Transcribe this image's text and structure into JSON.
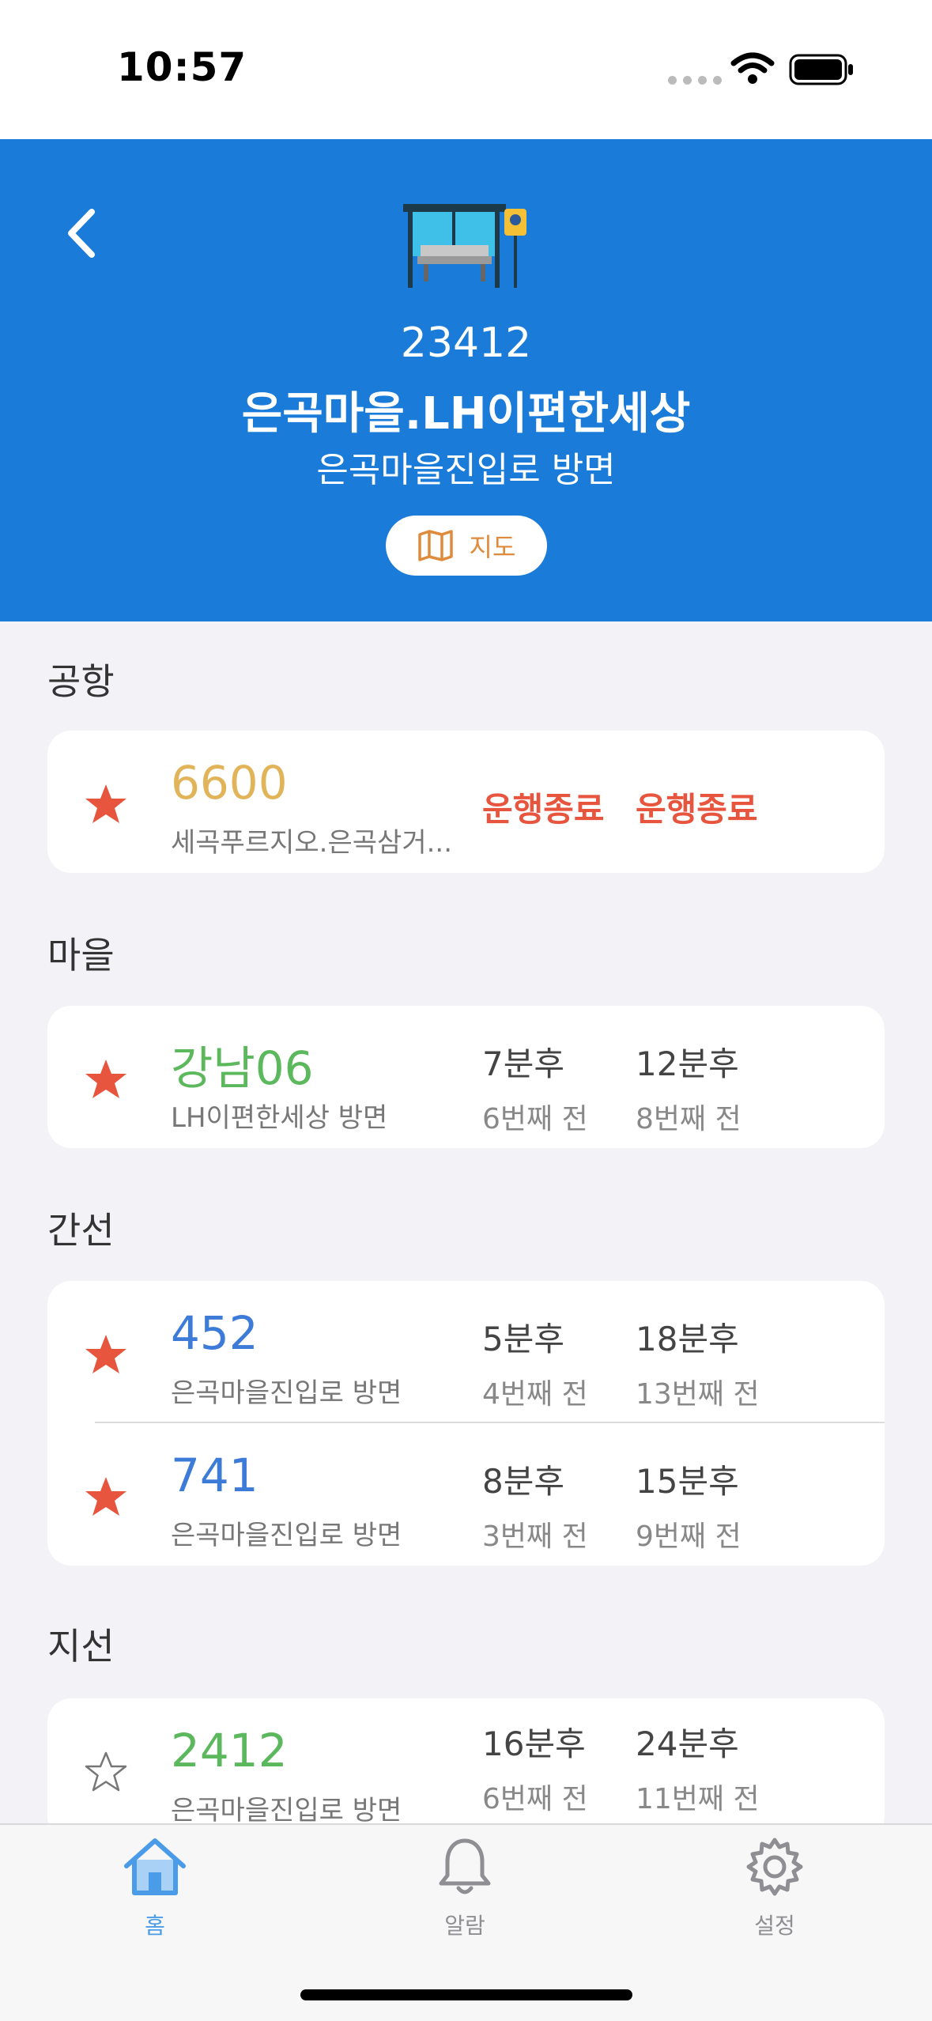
{
  "status_bar": {
    "time": "10:57"
  },
  "header": {
    "stop_id": "23412",
    "stop_name": "은곡마을.LH이편한세상",
    "direction": "은곡마을진입로 방면",
    "map_button_label": "지도"
  },
  "colors": {
    "header_bg": "#1a7bd9",
    "airport_route": "#e2b45a",
    "village_route": "#5cb85c",
    "trunk_route": "#3d7bd8",
    "branch_route": "#5cb85c",
    "star_active": "#e8553e",
    "ended_text": "#e8553e",
    "tab_active": "#4a9be8",
    "tab_inactive": "#8e8e93"
  },
  "sections": [
    {
      "title": "공항",
      "routes": [
        {
          "favorite": true,
          "number": "6600",
          "destination": "세곡푸르지오.은곡삼거...",
          "status1": "운행종료",
          "status2": "운행종료"
        }
      ]
    },
    {
      "title": "마을",
      "routes": [
        {
          "favorite": true,
          "number": "강남06",
          "destination": "LH이편한세상 방면",
          "arrival1": "7분후",
          "stops1": "6번째 전",
          "arrival2": "12분후",
          "stops2": "8번째 전"
        }
      ]
    },
    {
      "title": "간선",
      "routes": [
        {
          "favorite": true,
          "number": "452",
          "destination": "은곡마을진입로 방면",
          "arrival1": "5분후",
          "stops1": "4번째 전",
          "arrival2": "18분후",
          "stops2": "13번째 전"
        },
        {
          "favorite": true,
          "number": "741",
          "destination": "은곡마을진입로 방면",
          "arrival1": "8분후",
          "stops1": "3번째 전",
          "arrival2": "15분후",
          "stops2": "9번째 전"
        }
      ]
    },
    {
      "title": "지선",
      "routes": [
        {
          "favorite": false,
          "number": "2412",
          "destination": "은곡마을진입로 방면",
          "arrival1": "16분후",
          "stops1": "6번째 전",
          "arrival2": "24분후",
          "stops2": "11번째 전"
        }
      ]
    }
  ],
  "tabbar": {
    "tabs": [
      {
        "label": "홈",
        "icon": "home-icon",
        "active": true
      },
      {
        "label": "알람",
        "icon": "bell-icon",
        "active": false
      },
      {
        "label": "설정",
        "icon": "gear-icon",
        "active": false
      }
    ]
  }
}
